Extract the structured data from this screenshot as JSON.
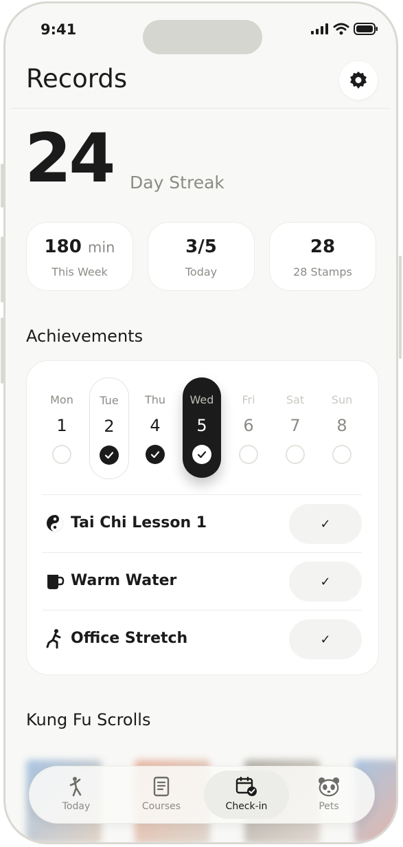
{
  "status": {
    "time": "9:41"
  },
  "header": {
    "title": "Records"
  },
  "streak": {
    "value": "24",
    "label": "Day Streak"
  },
  "stats": [
    {
      "value": "180",
      "unit": "min",
      "label": "This Week"
    },
    {
      "value": "3/5",
      "unit": "",
      "label": "Today"
    },
    {
      "value": "28",
      "unit": "",
      "label": "28 Stamps"
    }
  ],
  "achievements": {
    "title": "Achievements",
    "days": [
      {
        "name": "Mon",
        "num": "1",
        "state": "empty"
      },
      {
        "name": "Tue",
        "num": "2",
        "state": "done"
      },
      {
        "name": "Thu",
        "num": "4",
        "state": "done"
      },
      {
        "name": "Wed",
        "num": "5",
        "state": "today"
      },
      {
        "name": "Fri",
        "num": "6",
        "state": "empty"
      },
      {
        "name": "Sat",
        "num": "7",
        "state": "empty"
      },
      {
        "name": "Sun",
        "num": "8",
        "state": "empty"
      }
    ],
    "tasks": [
      {
        "label": "Tai Chi Lesson 1",
        "icon": "yin-yang-icon",
        "check": "✓"
      },
      {
        "label": "Warm Water",
        "icon": "mug-icon",
        "check": "✓"
      },
      {
        "label": "Office Stretch",
        "icon": "stretch-figure-icon",
        "check": "✓"
      }
    ]
  },
  "scrolls": {
    "title": "Kung Fu Scrolls"
  },
  "tabs": [
    {
      "label": "Today",
      "icon": "tai-chi-figure-icon",
      "active": false
    },
    {
      "label": "Courses",
      "icon": "document-icon",
      "active": false
    },
    {
      "label": "Check-in",
      "icon": "calendar-check-icon",
      "active": true
    },
    {
      "label": "Pets",
      "icon": "panda-icon",
      "active": false
    }
  ],
  "colors": {
    "ink": "#1b1b1b",
    "muted": "#8b8b86",
    "background": "#f8f8f6",
    "card": "#ffffff"
  }
}
